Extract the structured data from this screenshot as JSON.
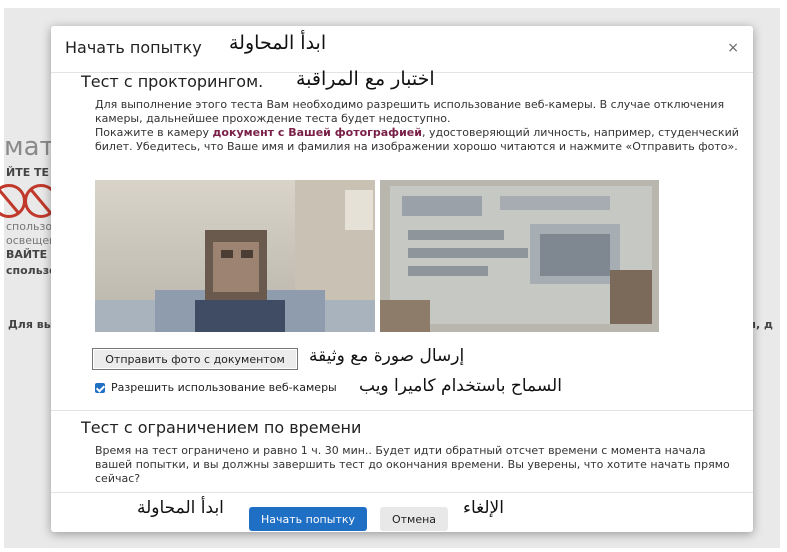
{
  "background": {
    "heading_fragment": "мати",
    "lines": [
      "ЙТЕ ТЕ",
      "спользо",
      "освещен",
      "ВАЙТЕ",
      "спользо"
    ],
    "left_text": "Для вы",
    "right_text": "ы, д"
  },
  "modal": {
    "title": "Начать попытку",
    "title_ar": "ابدأ المحاولة",
    "close_label": "×",
    "proctoring": {
      "title": "Тест с прокторингом.",
      "title_ar": "اختبار مع المراقبة",
      "para1": "Для выполнение этого теста Вам необходимо разрешить использование веб-камеры. В случае отключения камеры, дальнейшее прохождение теста будет недоступно.",
      "para2_start": "Покажите в камеру ",
      "para2_bold": "документ с Вашей фотографией",
      "para2_end": ", удостоверяющий личность, например, студенческий билет. Убедитесь, что Ваше имя и фамилия на изображении хорошо читаются и нажмите «Отправить фото».",
      "send_button": "Отправить фото с документом",
      "send_button_ar": "إرسال صورة مع وثيقة",
      "webcam_checkbox_label": "Разрешить использование веб-камеры",
      "webcam_checkbox_ar": "السماح باستخدام كاميرا ويب",
      "webcam_checked": true
    },
    "time_limit": {
      "title": "Тест с ограничением по времени",
      "text": "Время на тест ограничено и равно 1 ч. 30 мин.. Будет идти обратный отсчет времени с момента начала вашей попытки, и вы должны завершить тест до окончания времени. Вы уверены, что хотите начать прямо сейчас?"
    },
    "footer": {
      "start_ar": "ابدأ المحاولة",
      "start_button": "Начать попытку",
      "cancel_button": "Отмена",
      "cancel_ar": "الإلغاء"
    }
  },
  "colors": {
    "primary_button": "#1f6fc5",
    "bold_link": "#7a2048"
  }
}
